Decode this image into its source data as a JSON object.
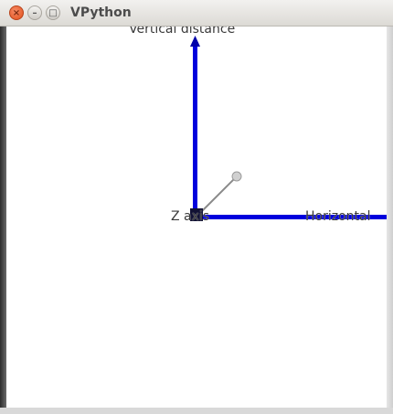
{
  "window": {
    "title": "VPython",
    "controls": {
      "close": "×",
      "minimize": "–",
      "maximize": "□"
    }
  },
  "scene": {
    "labels": {
      "vertical": "Vertical distance",
      "horizontal": "Horizontal",
      "z": "Z axis"
    },
    "colors": {
      "axis": "#0000dd",
      "origin_marker": "#111133",
      "ball": "#c8c8c8",
      "trail": "#8a8a8a"
    }
  }
}
